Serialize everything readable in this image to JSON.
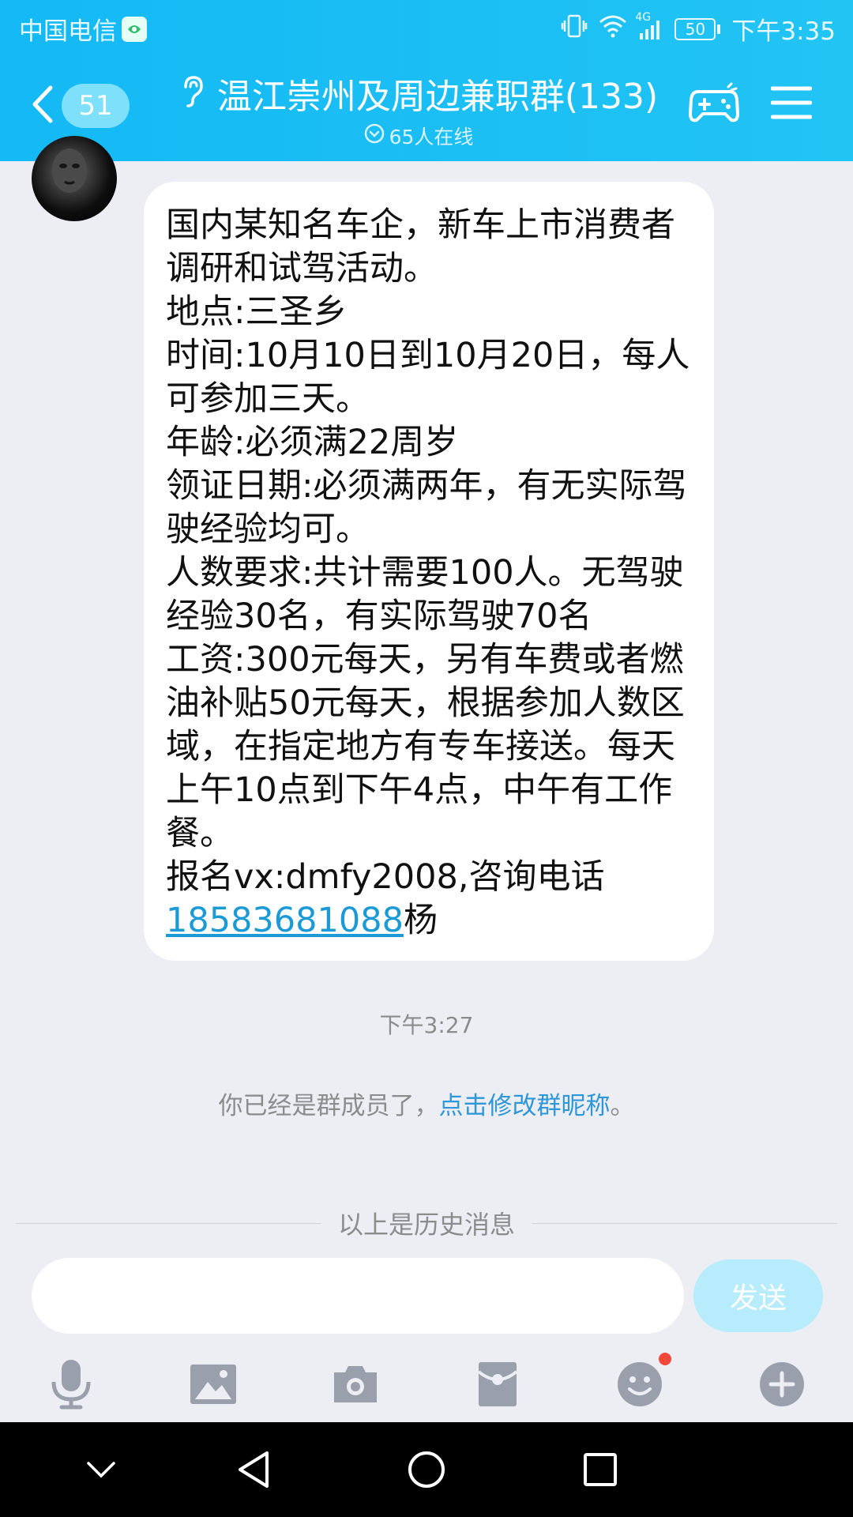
{
  "status_bar": {
    "carrier": "中国电信",
    "network": "4G",
    "battery": "50",
    "time": "下午3:35"
  },
  "header": {
    "unread_count": "51",
    "title": "温江崇州及周边兼职群(133)",
    "online": "65人在线",
    "bg_color": "#1ebff5"
  },
  "message": {
    "text": "国内某知名车企，新车上市消费者调研和试驾活动。\n地点:三圣乡\n时间:10月10日到10月20日，每人可参加三天。\n年龄:必须满22周岁\n领证日期:必须满两年，有无实际驾驶经验均可。\n人数要求:共计需要100人。无驾驶经验30名，有实际驾驶70名\n工资:300元每天，另有车费或者燃油补贴50元每天，根据参加人数区域，在指定地方有专车接送。每天上午10点到下午4点，中午有工作餐。\n报名vx:dmfy2008,咨询电话\n",
    "phone": "18583681088",
    "suffix": "杨"
  },
  "timestamp": "下午3:27",
  "system": {
    "prefix": "你已经是群成员了，",
    "link": "点击修改群昵称",
    "suffix": "。"
  },
  "history_divider": "以上是历史消息",
  "input": {
    "value": "",
    "send_label": "发送"
  },
  "toolbar_icons": [
    "microphone-icon",
    "image-icon",
    "camera-icon",
    "red-packet-icon",
    "emoji-icon",
    "plus-icon"
  ],
  "nav_icons": [
    "chevron-down-icon",
    "back-triangle-icon",
    "home-circle-icon",
    "recents-square-icon"
  ]
}
